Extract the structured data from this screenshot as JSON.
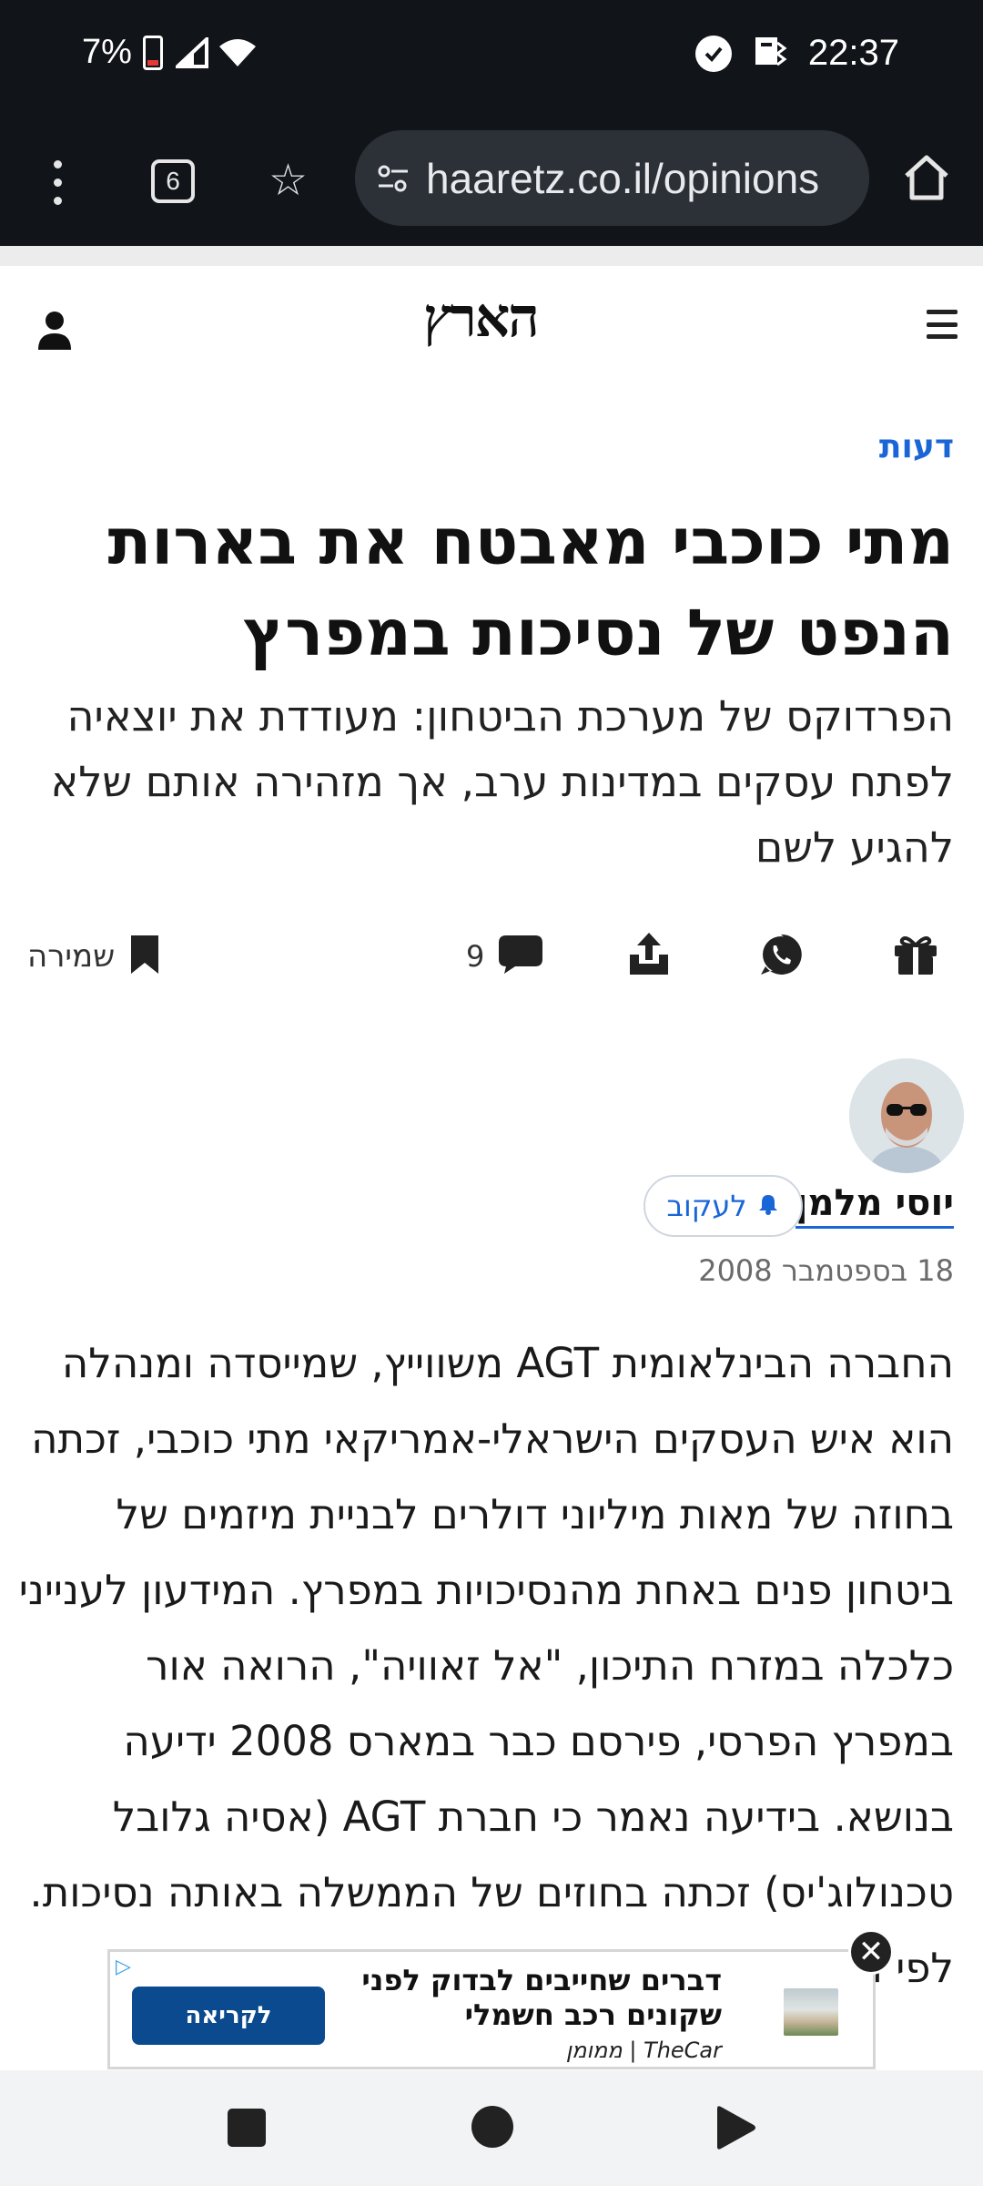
{
  "status_bar": {
    "battery_percent": "7%",
    "time": "22:37",
    "icons": [
      "battery-low-icon",
      "signal-icon",
      "wifi-icon",
      "check-circle-icon",
      "notification-icon"
    ]
  },
  "browser": {
    "url": "haaretz.co.il/opinions",
    "tab_count": "6",
    "icons": [
      "more-vert-icon",
      "tabs-icon",
      "star-icon",
      "site-settings-icon",
      "home-icon"
    ]
  },
  "site": {
    "logo": "הארץ"
  },
  "article": {
    "section": "דעות",
    "headline": "מתי כוכבי מאבטח את בארות הנפט של נסיכות במפרץ",
    "subheadline": "הפרדוקס של מערכת הביטחון: מעודדת את יוצאיה לפתח עסקים במדינות ערב, אך מזהירה אותם שלא להגיע לשם",
    "comments_count": "9",
    "save_label": "שמירה",
    "author": "יוסי מלמן",
    "follow_label": "לעקוב",
    "date": "18 בספטמבר 2008",
    "body": "החברה הבינלאומית AGT משווייץ, שמייסדה ומנהלה הוא איש העסקים הישראלי-אמריקאי מתי כוכבי, זכתה בחוזה של מאות מיליוני דולרים לבניית מיזמים של ביטחון פנים באחת מהנסיכויות במפרץ. המידעון לענייני כלכלה במזרח התיכון, \"אל זאוויה\", הרואה אור במפרץ הפרסי, פירסם כבר במארס 2008 ידיעה בנושא. בידיעה נאמר כי חברת AGT (אסיה גלובל טכנולוג'יס) זכתה בחוזים של הממשלה באותה נסיכות. לפי הידיעה,"
  },
  "ad": {
    "title": "דברים שחייבים לבדוק לפני שקונים רכב חשמלי",
    "source": "TheCar | ממומן",
    "cta": "לקריאה"
  },
  "colors": {
    "accent": "#1a66d6",
    "status_bar_bg": "#111418",
    "ad_button": "#0b4a8f"
  }
}
